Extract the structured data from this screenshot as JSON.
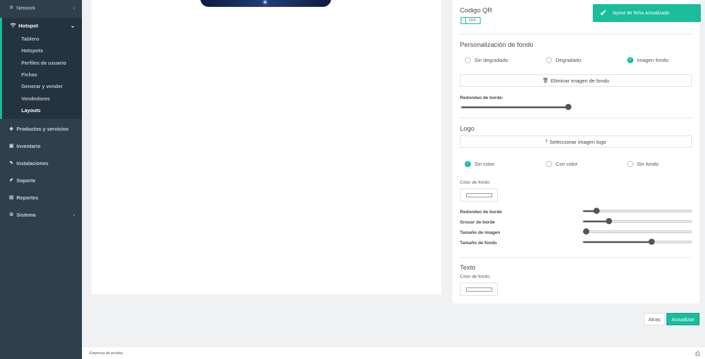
{
  "sidebar": {
    "network": {
      "label": "Network"
    },
    "hotspot": {
      "label": "Hotspot",
      "items": [
        {
          "label": "Tablero"
        },
        {
          "label": "Hotspots"
        },
        {
          "label": "Perfiles de usuario"
        },
        {
          "label": "Fichas"
        },
        {
          "label": "Generar y vender"
        },
        {
          "label": "Vendedores"
        },
        {
          "label": "Layouts"
        }
      ]
    },
    "menu": [
      {
        "label": "Productos y servicios"
      },
      {
        "label": "Inventario"
      },
      {
        "label": "Instalaciones"
      },
      {
        "label": "Soporte"
      },
      {
        "label": "Reportes"
      },
      {
        "label": "Sistema"
      }
    ]
  },
  "panel": {
    "qr": {
      "title": "Codigo QR",
      "toggle": "OFF"
    },
    "bg": {
      "title": "Personalización de fondo",
      "options": [
        "Sin degradado",
        "Degradado",
        "Imagen fondo"
      ],
      "selected": "Imagen fondo",
      "remove_button": "Eliminar imagen de fondo",
      "radius_label": "Redondeo de borde:",
      "radius_value": 1.0
    },
    "logo": {
      "title": "Logo",
      "select_button": "Seleccionar imagen logo",
      "options": [
        "Sin color",
        "Con color",
        "Sin fondo"
      ],
      "selected": "Sin color",
      "bg_color_label": "Color de fondo:",
      "bg_color": "#ffffff",
      "sliders": [
        {
          "label": "Redondeo de borde",
          "value": 0.1
        },
        {
          "label": "Grosor de borde",
          "value": 0.22
        },
        {
          "label": "Tamaño de imagen",
          "value": 0.0
        },
        {
          "label": "Tamaño de fondo",
          "value": 0.63
        }
      ]
    },
    "text": {
      "title": "Texto",
      "bg_color_label": "Color de fondo:",
      "bg_color": "#ffffff"
    }
  },
  "toast": {
    "message": "layout de ficha actualizado"
  },
  "actions": {
    "back": "Atras",
    "update": "Actualizar"
  },
  "footer": {
    "company": "Empresa de prueba"
  },
  "colors": {
    "accent": "#1abc9c",
    "sidebar": "#2f3f4e"
  }
}
